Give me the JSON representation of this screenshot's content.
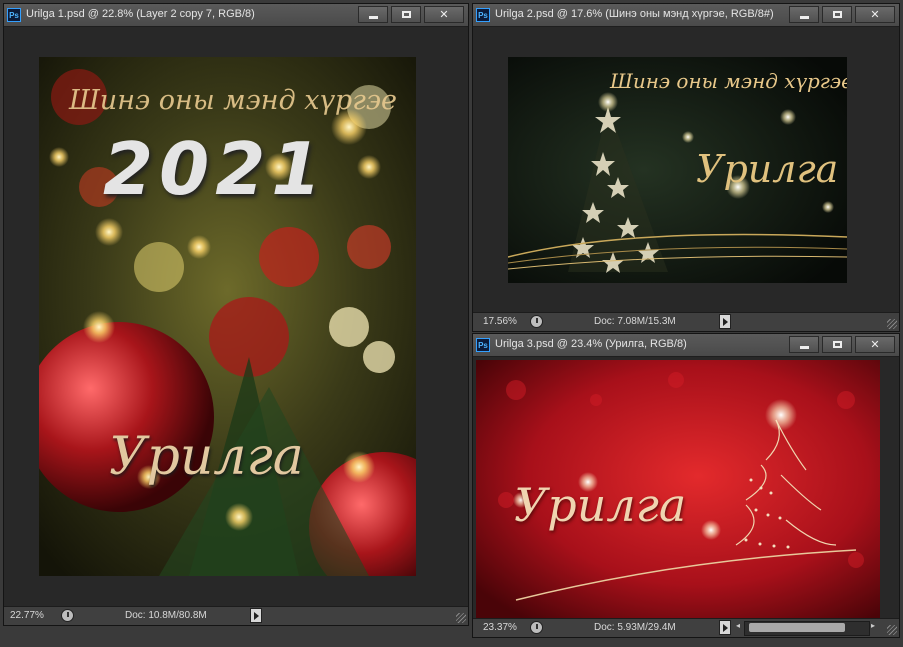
{
  "windows": [
    {
      "title": "Urilga 1.psd @ 22.8% (Layer 2 copy 7, RGB/8)",
      "zoom": "22.77%",
      "doc": "Doc: 10.8M/80.8M",
      "greeting": "Шинэ оны мэнд хүргэе",
      "year": "2021",
      "invite": "Урилга"
    },
    {
      "title": "Urilga 2.psd @ 17.6% (Шинэ оны мэнд хүргэе, RGB/8#)",
      "zoom": "17.56%",
      "doc": "Doc: 7.08M/15.3M",
      "greeting": "Шинэ оны мэнд хүргэе",
      "invite": "Урилга"
    },
    {
      "title": "Urilga 3.psd @ 23.4% (Урилга, RGB/8)",
      "zoom": "23.37%",
      "doc": "Doc: 5.93M/29.4M",
      "invite": "Урилга"
    }
  ],
  "icons": {
    "app": "Ps",
    "minimize": "minimize-icon",
    "maximize": "maximize-icon",
    "close": "✕"
  },
  "colors": {
    "gold": "#e8c98a",
    "red_bg": "#c0161c",
    "dark_bg": "#0e140e"
  }
}
